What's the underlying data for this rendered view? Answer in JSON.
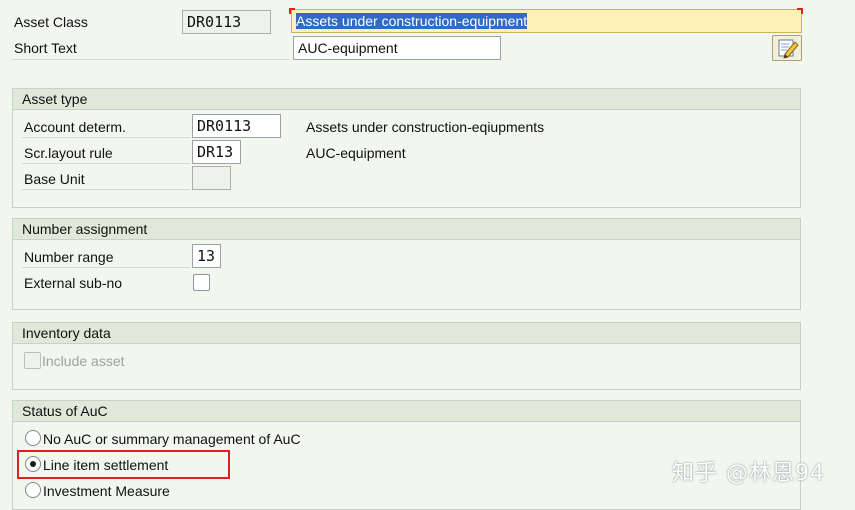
{
  "header": {
    "asset_class_label": "Asset Class",
    "asset_class_value": "DR0113",
    "asset_class_desc": "Assets under construction-equipment",
    "short_text_label": "Short Text",
    "short_text_value": "AUC-equipment",
    "edit_icon": "edit-pencil-icon"
  },
  "asset_type": {
    "title": "Asset type",
    "account_determ_label": "Account determ.",
    "account_determ_value": "DR0113",
    "account_determ_desc": "Assets under construction-eqiupments",
    "scr_layout_label": "Scr.layout rule",
    "scr_layout_value": "DR13",
    "scr_layout_desc": "AUC-equipment",
    "base_unit_label": "Base Unit",
    "base_unit_value": ""
  },
  "number_assignment": {
    "title": "Number assignment",
    "number_range_label": "Number range",
    "number_range_value": "13",
    "external_subno_label": "External sub-no",
    "external_subno_checked": false
  },
  "inventory": {
    "title": "Inventory data",
    "include_asset_label": "Include asset",
    "include_asset_checked": false
  },
  "status_auc": {
    "title": "Status of AuC",
    "options": [
      {
        "label": "No AuC or summary management of AuC",
        "selected": false
      },
      {
        "label": "Line item settlement",
        "selected": true
      },
      {
        "label": "Investment Measure",
        "selected": false
      }
    ]
  },
  "watermark": "知乎 @林恩94",
  "colors": {
    "background": "#f1f6ee",
    "group_header": "#dfe9d9",
    "required_field": "#fdf2b5",
    "selection": "#316ac5",
    "annotation": "#e02020"
  }
}
